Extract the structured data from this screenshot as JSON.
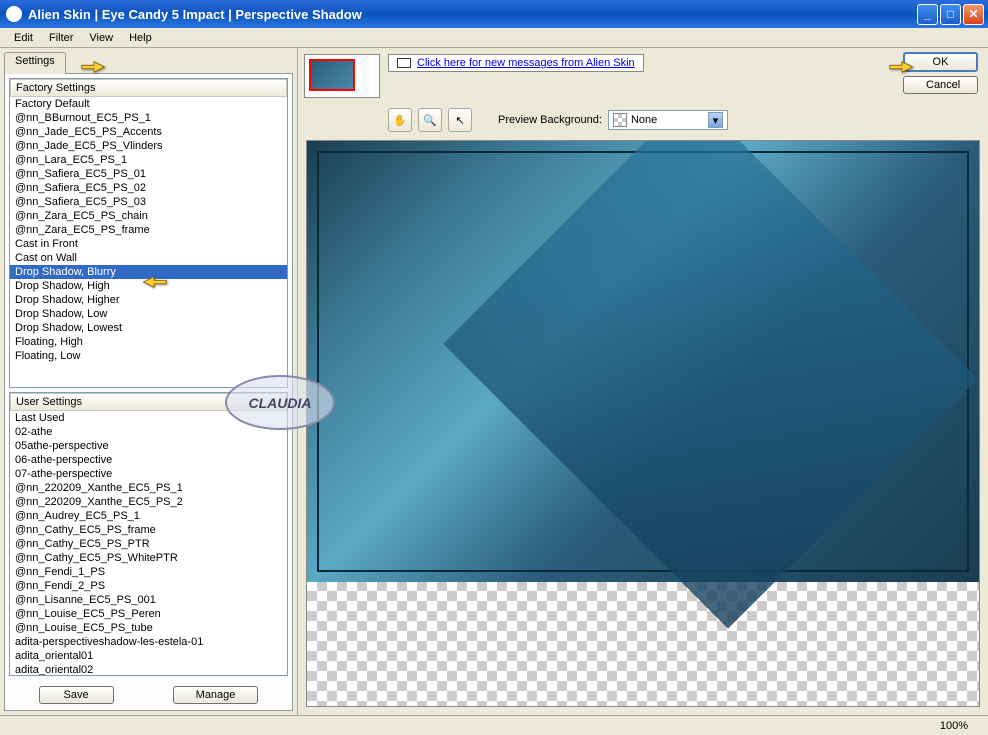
{
  "title": "Alien Skin  |  Eye Candy 5 Impact  |  Perspective Shadow",
  "menu": {
    "edit": "Edit",
    "filter": "Filter",
    "view": "View",
    "help": "Help"
  },
  "tab": {
    "settings": "Settings"
  },
  "factory": {
    "header": "Factory Settings",
    "items": [
      "Factory Default",
      "@nn_BBurnout_EC5_PS_1",
      "@nn_Jade_EC5_PS_Accents",
      "@nn_Jade_EC5_PS_Vlinders",
      "@nn_Lara_EC5_PS_1",
      "@nn_Safiera_EC5_PS_01",
      "@nn_Safiera_EC5_PS_02",
      "@nn_Safiera_EC5_PS_03",
      "@nn_Zara_EC5_PS_chain",
      "@nn_Zara_EC5_PS_frame",
      "Cast in Front",
      "Cast on Wall",
      "Drop Shadow, Blurry",
      "Drop Shadow, High",
      "Drop Shadow, Higher",
      "Drop Shadow, Low",
      "Drop Shadow, Lowest",
      "Floating, High",
      "Floating, Low"
    ],
    "selected_index": 12
  },
  "user": {
    "header": "User Settings",
    "items": [
      "Last Used",
      "02-athe",
      "05athe-perspective",
      "06-athe-perspective",
      "07-athe-perspective",
      "@nn_220209_Xanthe_EC5_PS_1",
      "@nn_220209_Xanthe_EC5_PS_2",
      "@nn_Audrey_EC5_PS_1",
      "@nn_Cathy_EC5_PS_frame",
      "@nn_Cathy_EC5_PS_PTR",
      "@nn_Cathy_EC5_PS_WhitePTR",
      "@nn_Fendi_1_PS",
      "@nn_Fendi_2_PS",
      "@nn_Lisanne_EC5_PS_001",
      "@nn_Louise_EC5_PS_Peren",
      "@nn_Louise_EC5_PS_tube",
      "adita-perspectiveshadow-les-estela-01",
      "adita_oriental01",
      "adita_oriental02"
    ]
  },
  "buttons": {
    "save": "Save",
    "manage": "Manage",
    "ok": "OK",
    "cancel": "Cancel"
  },
  "msg_link": "Click here for new messages from Alien Skin",
  "preview_bg_label": "Preview Background:",
  "preview_bg_value": "None",
  "zoom": "100%",
  "watermark": "CLAUDIA"
}
